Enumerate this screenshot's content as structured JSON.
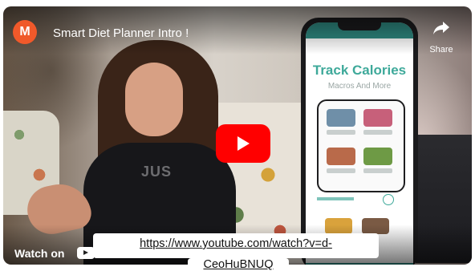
{
  "channel": {
    "avatar_letter": "M",
    "avatar_color": "#f0592a"
  },
  "video": {
    "title": "Smart Diet Planner Intro !",
    "shirt_text": "JUS"
  },
  "actions": {
    "share_icon": "share-arrow-icon",
    "share_label": "Share"
  },
  "player": {
    "play_button_color": "#ff0000",
    "play_icon": "play-icon"
  },
  "phone_app": {
    "title": "Track Calories",
    "subtitle": "Macros And More",
    "accent_color": "#3ea99a"
  },
  "footer": {
    "watch_on_label": "Watch on",
    "youtube_icon": "youtube-logo-icon"
  },
  "caption": {
    "url_line1": "https://www.youtube.com/watch?v=d-",
    "url_line2": "CeoHuBNUQ"
  }
}
